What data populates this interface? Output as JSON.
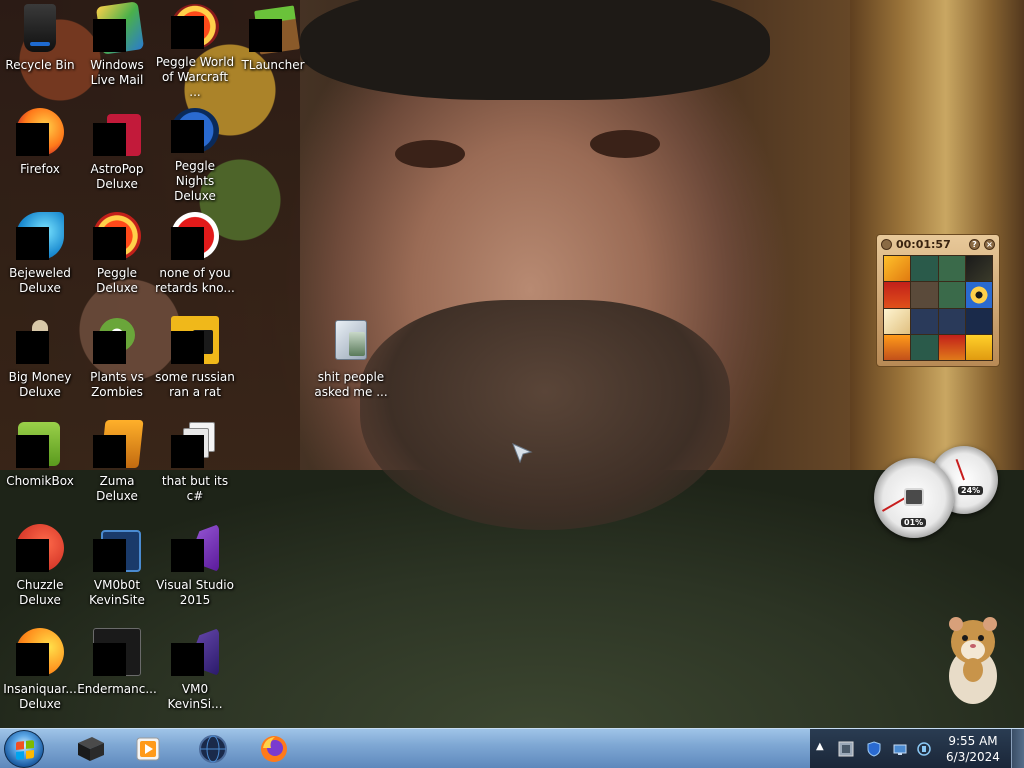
{
  "desktop": {
    "icons": [
      {
        "name": "recycle-bin-icon",
        "label": "Recycle Bin"
      },
      {
        "name": "windows-live-mail-icon",
        "label": "Windows Live Mail"
      },
      {
        "name": "peggle-world-of-warcraft-icon",
        "label": "Peggle World of Warcraft ..."
      },
      {
        "name": "tlauncher-icon",
        "label": "TLauncher"
      },
      {
        "name": "firefox-icon",
        "label": "Firefox"
      },
      {
        "name": "astropop-deluxe-icon",
        "label": "AstroPop Deluxe"
      },
      {
        "name": "peggle-nights-deluxe-icon",
        "label": "Peggle Nights Deluxe"
      },
      {
        "name": "bejeweled-deluxe-icon",
        "label": "Bejeweled Deluxe"
      },
      {
        "name": "peggle-deluxe-icon",
        "label": "Peggle Deluxe"
      },
      {
        "name": "none-of-you-icon",
        "label": "none of you retards kno..."
      },
      {
        "name": "big-money-deluxe-icon",
        "label": "Big Money Deluxe"
      },
      {
        "name": "plants-vs-zombies-icon",
        "label": "Plants vs Zombies"
      },
      {
        "name": "some-russian-icon",
        "label": "some russian ran a rat"
      },
      {
        "name": "shit-people-folder-icon",
        "label": "shit people asked me ..."
      },
      {
        "name": "chomikbox-icon",
        "label": "ChomikBox"
      },
      {
        "name": "zuma-deluxe-icon",
        "label": "Zuma Deluxe"
      },
      {
        "name": "that-but-its-csharp-icon",
        "label": "that but its c#"
      },
      {
        "name": "chuzzle-deluxe-icon",
        "label": "Chuzzle Deluxe"
      },
      {
        "name": "vm0b0t-kevinsite-icon",
        "label": "VM0b0t KevinSite"
      },
      {
        "name": "visual-studio-2015-icon",
        "label": "Visual Studio 2015"
      },
      {
        "name": "insaniquarium-deluxe-icon",
        "label": "Insaniquar... Deluxe"
      },
      {
        "name": "endermanch-icon",
        "label": "Endermanc..."
      },
      {
        "name": "vm0-kevinsi-icon",
        "label": "VM0 KevinSi..."
      }
    ]
  },
  "gadgets": {
    "puzzle": {
      "timer": "00:01:57",
      "help_symbol": "?",
      "close_symbol": "×"
    },
    "cpu_meter": {
      "cpu_label": "01%",
      "memory_label": "24%"
    }
  },
  "taskbar": {
    "pinned": [
      {
        "name": "taskbar-item-app1",
        "icon": "black-box-icon"
      },
      {
        "name": "taskbar-item-media-player",
        "icon": "media-player-icon"
      },
      {
        "name": "taskbar-item-globe",
        "icon": "globe-icon"
      },
      {
        "name": "taskbar-item-firefox",
        "icon": "firefox-icon"
      }
    ],
    "tray": {
      "overflow_symbol": "▲"
    },
    "clock": {
      "time": "9:55 AM",
      "date": "6/3/2024"
    }
  },
  "colors": {
    "taskbar_top": "#9fc4e8",
    "taskbar_bottom": "#5e88bc",
    "tray_bg": "#1a2638",
    "label_text": "#ffffff"
  }
}
